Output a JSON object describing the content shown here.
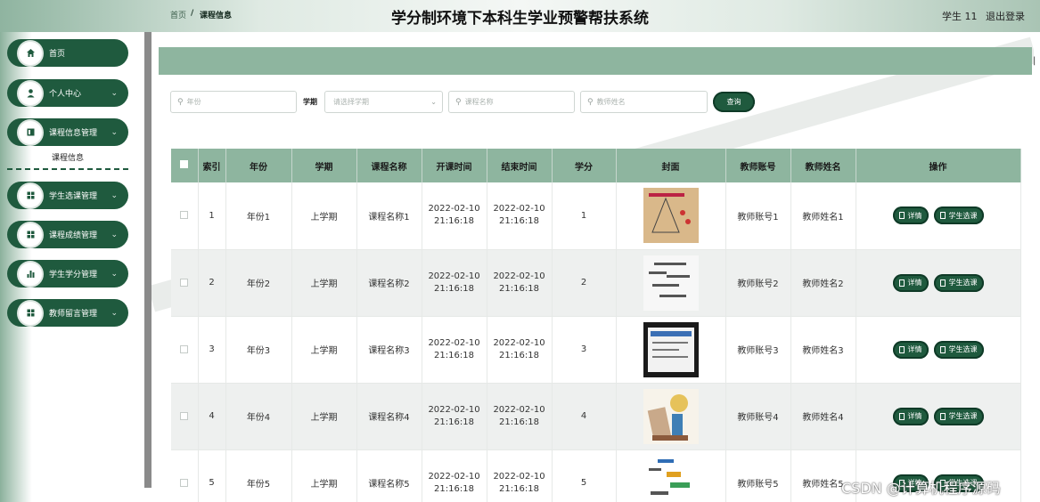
{
  "app": {
    "title": "学分制环境下本科生学业预警帮扶系统",
    "user": "学生 11",
    "logout": "退出登录"
  },
  "sidebar": {
    "items": [
      {
        "label": "首页",
        "icon": "home-icon",
        "has_chevron": false
      },
      {
        "label": "个人中心",
        "icon": "person-icon",
        "has_chevron": true
      },
      {
        "label": "课程信息管理",
        "icon": "book-icon",
        "has_chevron": true
      },
      {
        "label": "学生选课管理",
        "icon": "grid-icon",
        "has_chevron": true
      },
      {
        "label": "课程成绩管理",
        "icon": "grid-icon",
        "has_chevron": true
      },
      {
        "label": "学生学分管理",
        "icon": "bar-chart-icon",
        "has_chevron": true
      },
      {
        "label": "教师留言管理",
        "icon": "grid-icon",
        "has_chevron": true
      }
    ],
    "submenu": {
      "label": "课程信息"
    }
  },
  "breadcrumb": {
    "home": "首页",
    "sep": "/",
    "current": "课程信息"
  },
  "search": {
    "year_placeholder": "年份",
    "semester_label": "学期",
    "semester_placeholder": "请选择学期",
    "course_placeholder": "课程名称",
    "teacher_placeholder": "教师姓名",
    "query_label": "查询"
  },
  "table": {
    "headers": [
      "索引",
      "年份",
      "学期",
      "课程名称",
      "开课时间",
      "结束时间",
      "学分",
      "封面",
      "教师账号",
      "教师姓名",
      "操作"
    ],
    "rows": [
      {
        "index": "1",
        "year": "年份1",
        "semester": "上学期",
        "course": "课程名称1",
        "start_date": "2022-02-10",
        "start_time": "21:16:18",
        "end_date": "2022-02-10",
        "end_time": "21:16:18",
        "credit": "1",
        "teacher_account": "教师账号1",
        "teacher_name": "教师姓名1"
      },
      {
        "index": "2",
        "year": "年份2",
        "semester": "上学期",
        "course": "课程名称2",
        "start_date": "2022-02-10",
        "start_time": "21:16:18",
        "end_date": "2022-02-10",
        "end_time": "21:16:18",
        "credit": "2",
        "teacher_account": "教师账号2",
        "teacher_name": "教师姓名2"
      },
      {
        "index": "3",
        "year": "年份3",
        "semester": "上学期",
        "course": "课程名称3",
        "start_date": "2022-02-10",
        "start_time": "21:16:18",
        "end_date": "2022-02-10",
        "end_time": "21:16:18",
        "credit": "3",
        "teacher_account": "教师账号3",
        "teacher_name": "教师姓名3"
      },
      {
        "index": "4",
        "year": "年份4",
        "semester": "上学期",
        "course": "课程名称4",
        "start_date": "2022-02-10",
        "start_time": "21:16:18",
        "end_date": "2022-02-10",
        "end_time": "21:16:18",
        "credit": "4",
        "teacher_account": "教师账号4",
        "teacher_name": "教师姓名4"
      },
      {
        "index": "5",
        "year": "年份5",
        "semester": "上学期",
        "course": "课程名称5",
        "start_date": "2022-02-10",
        "start_time": "21:16:18",
        "end_date": "2022-02-10",
        "end_time": "21:16:18",
        "credit": "5",
        "teacher_account": "教师账号5",
        "teacher_name": "教师姓名5"
      }
    ],
    "actions": {
      "detail": "详情",
      "select": "学生选课"
    }
  },
  "watermark": "CSDN @计算机程序源码",
  "colors": {
    "primary": "#1f5a3e",
    "header_bg": "#8eb59f",
    "row_alt": "#eef0ef"
  }
}
